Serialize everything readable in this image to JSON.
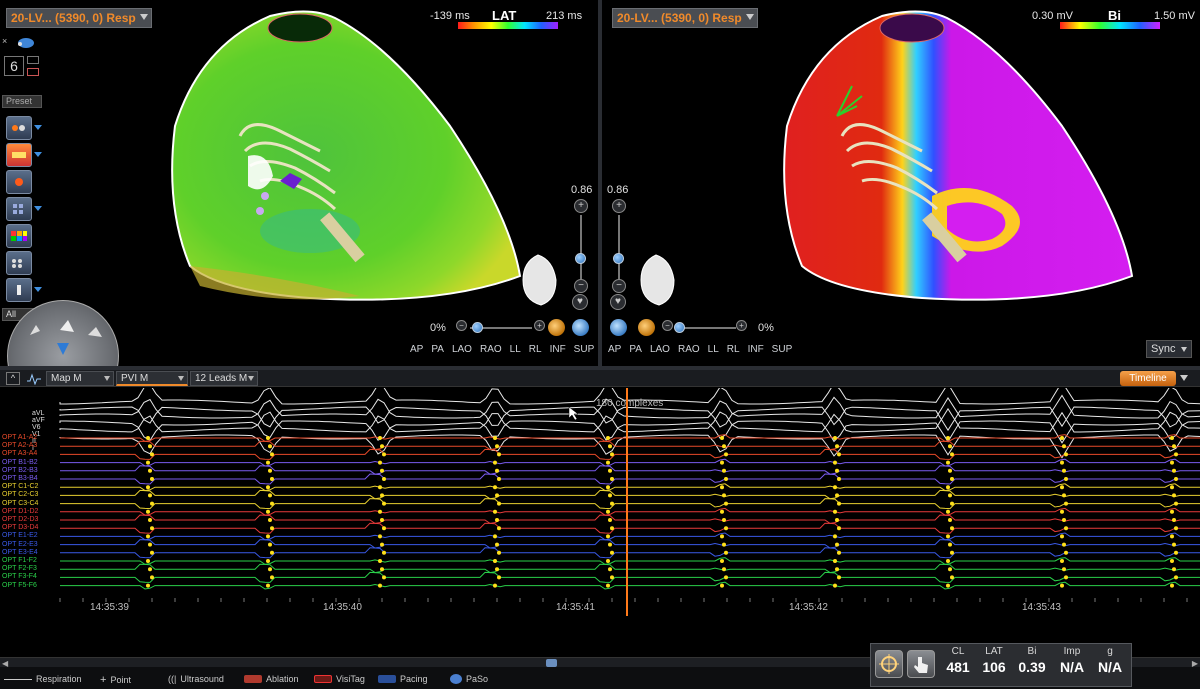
{
  "left_map": {
    "selector_label": "20-LV... (5390, 0) Resp",
    "colorbar": {
      "title": "LAT",
      "min_label": "-139 ms",
      "max_label": "213 ms"
    },
    "zoom": "0.86",
    "transparency": "0%",
    "views": [
      "AP",
      "PA",
      "LAO",
      "RAO",
      "LL",
      "RL",
      "INF",
      "SUP"
    ]
  },
  "right_map": {
    "selector_label": "20-LV... (5390, 0) Resp",
    "colorbar": {
      "title": "Bi",
      "min_label": "0.30 mV",
      "max_label": "1.50 mV"
    },
    "zoom": "0.86",
    "transparency": "0%",
    "views": [
      "AP",
      "PA",
      "LAO",
      "RAO",
      "LL",
      "RL",
      "INF",
      "SUP"
    ],
    "sync_label": "Sync"
  },
  "toolbar": {
    "number": "6",
    "preset_label": "Preset",
    "filter_label": "All",
    "icons": [
      "catheter-icon",
      "points-icon",
      "color-map-icon",
      "tag-icon",
      "grid-icon",
      "rainbow-grid-icon",
      "dots-grid-icon",
      "electrode-icon"
    ]
  },
  "signal_panel": {
    "selectors": [
      "Map M",
      "PVI M",
      "12 Leads M"
    ],
    "timeline_label": "Timeline",
    "annotation": "180 complexes",
    "time_labels": [
      "14:35:39",
      "14:35:40",
      "14:35:41",
      "14:35:42",
      "14:35:43"
    ],
    "channel_labels_ecg": [
      "aVL",
      "aVF",
      "V6",
      "V1",
      "II",
      "I"
    ],
    "channel_labels_opt": [
      "OPT A1-A2",
      "OPT A2-A3",
      "OPT A3-A4",
      "OPT B1-B2",
      "OPT B2-B3",
      "OPT B3-B4",
      "OPT C1-C2",
      "OPT C2-C3",
      "OPT C3-C4",
      "OPT D1-D2",
      "OPT D2-D3",
      "OPT D3-D4",
      "OPT E1-E2",
      "OPT E2-E3",
      "OPT E3-E4",
      "OPT F1-F2",
      "OPT F2-F3",
      "OPT F3-F4",
      "OPT F5-F6"
    ]
  },
  "legend": {
    "respiration": "Respiration",
    "point": "Point",
    "ultrasound": "Ultrasound",
    "ablation": "Ablation",
    "visitag": "VisiTag",
    "pacing": "Pacing",
    "paso": "PaSo"
  },
  "readout": {
    "headers": [
      "CL",
      "LAT",
      "Bi",
      "Imp",
      "g"
    ],
    "values": [
      "481",
      "106",
      "0.39",
      "N/A",
      "N/A"
    ]
  },
  "colors": {
    "accent_orange": "#f08a2a",
    "timeline_orange": "#e87b18",
    "cursor_line": "#ff7a1a"
  }
}
